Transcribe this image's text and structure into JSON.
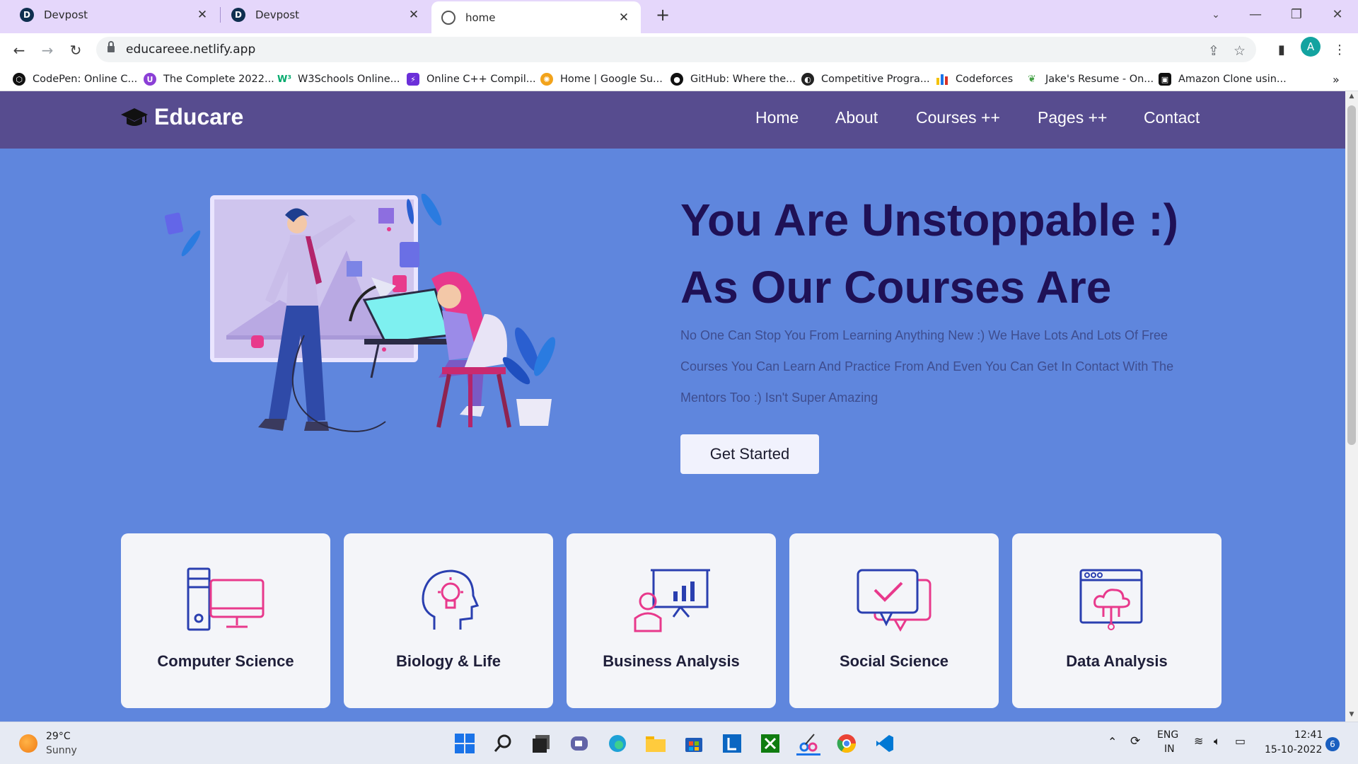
{
  "browser": {
    "tabs": [
      {
        "title": "Devpost",
        "favicon": "devpost-icon"
      },
      {
        "title": "Devpost",
        "favicon": "devpost-icon"
      },
      {
        "title": "home",
        "favicon": "globe-icon",
        "active": true
      }
    ],
    "url": "educareee.netlify.app",
    "profile_initial": "A",
    "bookmarks": [
      "CodePen: Online C...",
      "The Complete 2022...",
      "W3Schools Online...",
      "Online C++ Compil...",
      "Home | Google Su...",
      "GitHub: Where the...",
      "Competitive Progra...",
      "Codeforces",
      "Jake's Resume - On...",
      "Amazon Clone usin..."
    ]
  },
  "site": {
    "brand": "Educare",
    "nav": [
      "Home",
      "About",
      "Courses ++",
      "Pages ++",
      "Contact"
    ],
    "hero": {
      "title_line1": "You Are Unstoppable :)",
      "title_line2": "As Our Courses Are",
      "description": "No One Can Stop You From Learning Anything New :) We Have Lots And Lots Of Free Courses You Can Learn And Practice From And Even You Can Get In Contact With The Mentors Too :) Isn't Super Amazing",
      "cta": "Get Started"
    },
    "categories": [
      {
        "label": "Computer Science",
        "icon": "computer-icon"
      },
      {
        "label": "Biology & Life",
        "icon": "head-lightbulb-icon"
      },
      {
        "label": "Business Analysis",
        "icon": "presentation-icon"
      },
      {
        "label": "Social Science",
        "icon": "chat-check-icon"
      },
      {
        "label": "Data Analysis",
        "icon": "cloud-data-icon"
      }
    ],
    "colors": {
      "navbar": "#574c8f",
      "background": "#5f86dd",
      "title": "#1f1156",
      "icon_blue": "#2a3fb0",
      "icon_pink": "#e8398c"
    }
  },
  "taskbar": {
    "weather_temp": "29°C",
    "weather_desc": "Sunny",
    "lang_line1": "ENG",
    "lang_line2": "IN",
    "time": "12:41",
    "date": "15-10-2022",
    "notifications": "6"
  }
}
